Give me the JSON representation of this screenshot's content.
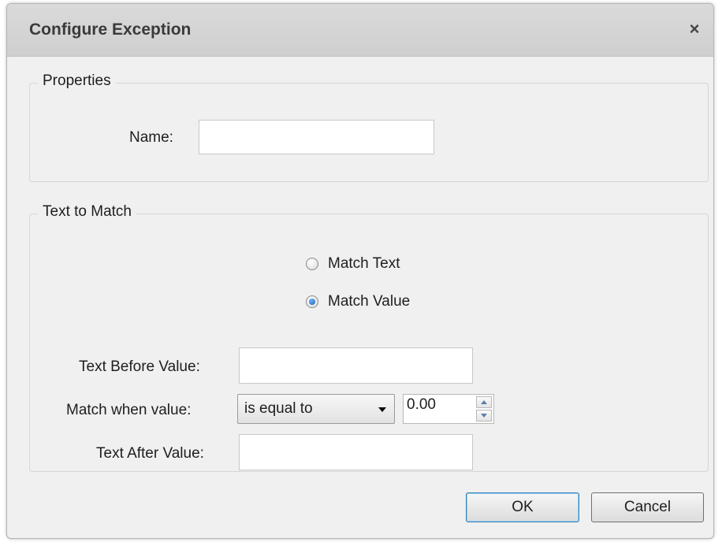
{
  "dialog": {
    "title": "Configure Exception",
    "close_symbol": "×"
  },
  "properties": {
    "legend": "Properties",
    "name_label": "Name:",
    "name_value": ""
  },
  "text_to_match": {
    "legend": "Text to Match",
    "radio_options": [
      {
        "label": "Match Text",
        "checked": false
      },
      {
        "label": "Match Value",
        "checked": true
      }
    ],
    "text_before_label": "Text Before Value:",
    "text_before_value": "",
    "match_when_label": "Match when value:",
    "comparison_selected": "is equal to",
    "numeric_value": "0.00",
    "text_after_label": "Text After Value:",
    "text_after_value": ""
  },
  "buttons": {
    "ok": "OK",
    "cancel": "Cancel"
  }
}
